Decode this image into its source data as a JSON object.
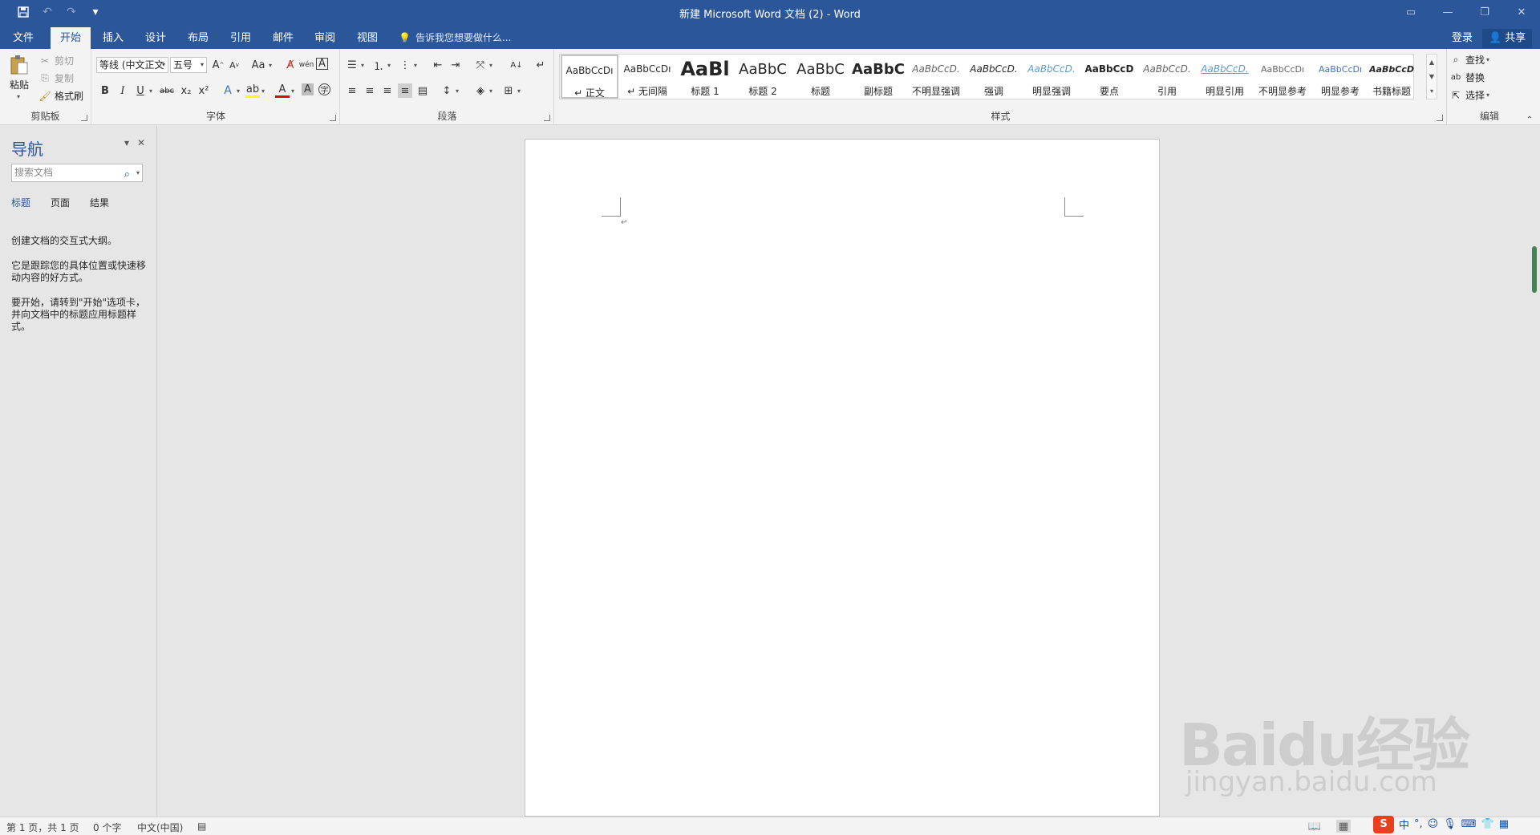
{
  "window": {
    "title": "新建 Microsoft Word 文档 (2) - Word",
    "qat": {
      "save_icon": "save-icon",
      "undo_icon": "undo-icon",
      "redo_icon": "redo-icon",
      "customize": "▾"
    }
  },
  "tabs": [
    "文件",
    "开始",
    "插入",
    "设计",
    "布局",
    "引用",
    "邮件",
    "审阅",
    "视图"
  ],
  "active_tab": "开始",
  "tell_me": "告诉我您想要做什么...",
  "account": {
    "login": "登录",
    "share": "共享"
  },
  "ribbon": {
    "clipboard": {
      "label": "剪贴板",
      "paste": "粘贴",
      "cut": "剪切",
      "copy": "复制",
      "format_painter": "格式刷"
    },
    "font": {
      "label": "字体",
      "font_name": "等线 (中文正文",
      "font_size": "五号",
      "bold": "B",
      "italic": "I",
      "underline": "U",
      "strikethrough": "abc",
      "subscript": "x₂",
      "superscript": "x²",
      "case": "Aa",
      "grow": "A",
      "shrink": "A"
    },
    "paragraph": {
      "label": "段落"
    },
    "styles": {
      "label": "样式",
      "items": [
        {
          "sample": "AaBbCcDı",
          "name": "↵ 正文"
        },
        {
          "sample": "AaBbCcDı",
          "name": "↵ 无间隔"
        },
        {
          "sample": "AaBl",
          "name": "标题 1"
        },
        {
          "sample": "AaBbC",
          "name": "标题 2"
        },
        {
          "sample": "AaBbC",
          "name": "标题"
        },
        {
          "sample": "AaBbC",
          "name": "副标题"
        },
        {
          "sample": "AaBbCcD.",
          "name": "不明显强调"
        },
        {
          "sample": "AaBbCcD.",
          "name": "强调"
        },
        {
          "sample": "AaBbCcD.",
          "name": "明显强调"
        },
        {
          "sample": "AaBbCcD",
          "name": "要点"
        },
        {
          "sample": "AaBbCcD.",
          "name": "引用"
        },
        {
          "sample": "AaBbCcD.",
          "name": "明显引用"
        },
        {
          "sample": "AaBbCcDı",
          "name": "不明显参考"
        },
        {
          "sample": "AaBbCcDı",
          "name": "明显参考"
        },
        {
          "sample": "AaBbCcD",
          "name": "书籍标题"
        }
      ]
    },
    "editing": {
      "label": "编辑",
      "find": "查找",
      "replace": "替换",
      "select": "选择"
    }
  },
  "nav": {
    "title": "导航",
    "search_placeholder": "搜索文档",
    "tabs": [
      "标题",
      "页面",
      "结果"
    ],
    "active_tab": "标题",
    "p1": "创建文档的交互式大纲。",
    "p2": "它是跟踪您的具体位置或快速移动内容的好方式。",
    "p3": "要开始，请转到\"开始\"选项卡，并向文档中的标题应用标题样式。"
  },
  "document": {
    "paragraph_mark": "↵"
  },
  "status": {
    "page": "第 1 页，共 1 页",
    "words": "0 个字",
    "language": "中文(中国)"
  },
  "ime": {
    "logo": "S",
    "mode": "中",
    "punct": "°,",
    "emoji": "☺"
  },
  "watermark": {
    "brand": "Baidu经验",
    "url": "jingyan.baidu.com"
  },
  "colors": {
    "title_bar": "#2b579a",
    "ribbon": "#f3f3f3",
    "canvas": "#e6e6e6",
    "accent": "#2b579a"
  }
}
